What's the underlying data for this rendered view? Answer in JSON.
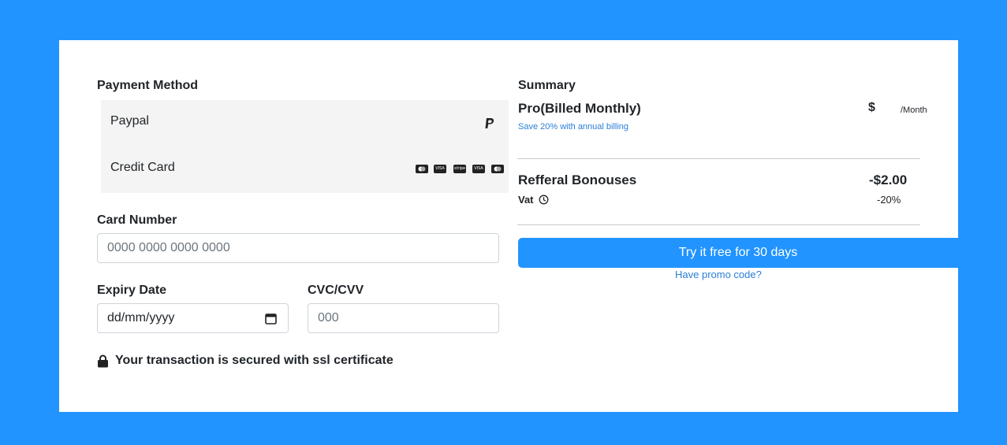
{
  "payment": {
    "heading": "Payment Method",
    "methods": [
      {
        "label": "Paypal",
        "icon": "paypal-icon"
      },
      {
        "label": "Credit Card",
        "icons": [
          "mastercard-icon",
          "visa-icon",
          "stripe-icon",
          "visa-icon",
          "mastercard-icon"
        ],
        "icon_texts": [
          "",
          "VISA",
          "stripe",
          "VISA",
          ""
        ]
      }
    ],
    "card_number": {
      "label": "Card Number",
      "placeholder": "0000 0000 0000 0000"
    },
    "expiry": {
      "label": "Expiry Date",
      "placeholder": "dd/mm/yyyy"
    },
    "cvc": {
      "label": "CVC/CVV",
      "placeholder": "000"
    },
    "secure_note": "Your transaction is secured with ssl certificate"
  },
  "summary": {
    "heading": "Summary",
    "plan": "Pro(Billed Monthly)",
    "price_symbol": "$",
    "price_period": "/Month",
    "save_note": "Save 20% with annual billing",
    "referral_label": "Refferal Bonouses",
    "referral_value": "-$2.00",
    "vat_label": "Vat",
    "vat_value": "-20%",
    "cta": "Try it free for 30 days",
    "promo": "Have promo code?"
  },
  "colors": {
    "accent": "#2194ff",
    "link": "#2a7fd8",
    "methods_bg": "#f4f4f4"
  }
}
